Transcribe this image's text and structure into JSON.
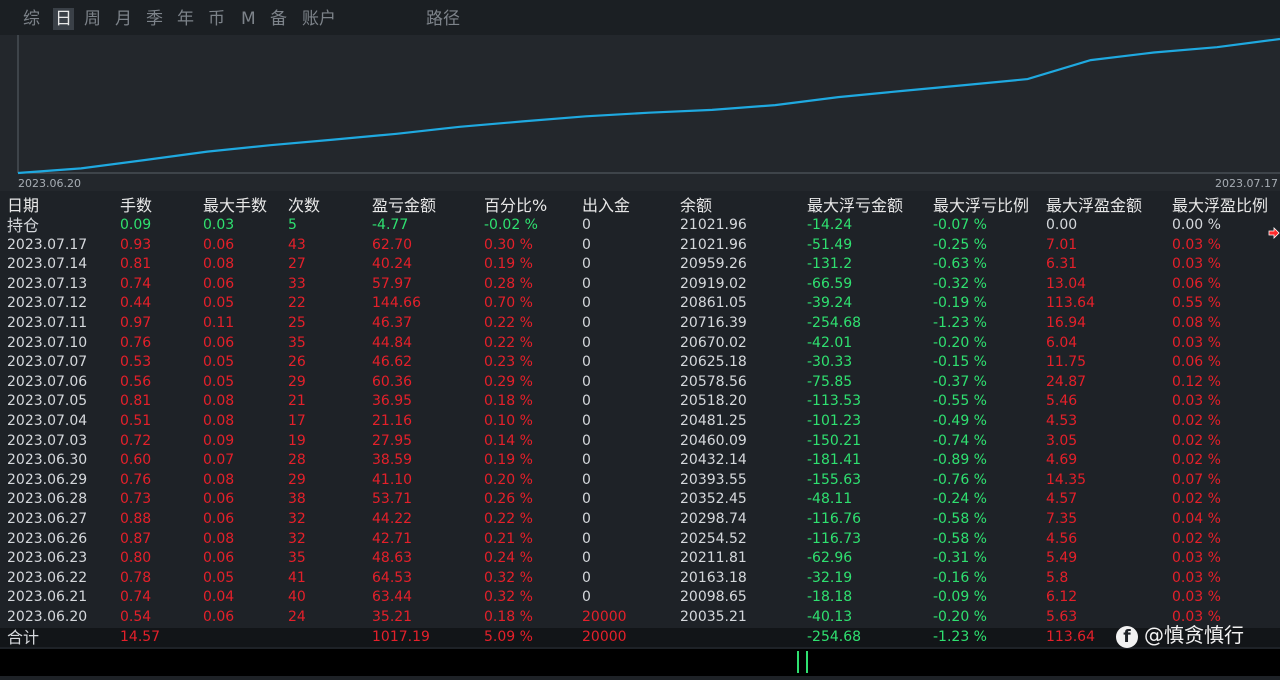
{
  "tabs": [
    "综",
    "日",
    "周",
    "月",
    "季",
    "年",
    "币",
    "M",
    "备",
    "账户",
    "路径"
  ],
  "active_tab": 1,
  "chart": {
    "start_label": "2023.06.20",
    "end_label": "2023.07.17",
    "line_color": "#1fa9e0",
    "series_values": [
      20035.21,
      20098.65,
      20163.18,
      20211.81,
      20254.52,
      20298.74,
      20352.45,
      20393.55,
      20432.14,
      20460.09,
      20481.25,
      20518.2,
      20578.56,
      20625.18,
      20670.02,
      20716.39,
      20861.05,
      20919.02,
      20959.26,
      21021.96
    ],
    "start_value": 20000
  },
  "columns": [
    "日期",
    "手数",
    "最大手数",
    "次数",
    "盈亏金额",
    "百分比%",
    "出入金",
    "余额",
    "最大浮亏金额",
    "最大浮亏比例",
    "最大浮盈金额",
    "最大浮盈比例"
  ],
  "position_row": [
    "持仓",
    "0.09",
    "0.03",
    "5",
    "-4.77",
    "-0.02 %",
    "0",
    "21021.96",
    "-14.24",
    "-0.07 %",
    "0.00",
    "0.00 %"
  ],
  "rows": [
    [
      "2023.07.17",
      "0.93",
      "0.06",
      "43",
      "62.70",
      "0.30 %",
      "0",
      "21021.96",
      "-51.49",
      "-0.25 %",
      "7.01",
      "0.03 %"
    ],
    [
      "2023.07.14",
      "0.81",
      "0.08",
      "27",
      "40.24",
      "0.19 %",
      "0",
      "20959.26",
      "-131.2",
      "-0.63 %",
      "6.31",
      "0.03 %"
    ],
    [
      "2023.07.13",
      "0.74",
      "0.06",
      "33",
      "57.97",
      "0.28 %",
      "0",
      "20919.02",
      "-66.59",
      "-0.32 %",
      "13.04",
      "0.06 %"
    ],
    [
      "2023.07.12",
      "0.44",
      "0.05",
      "22",
      "144.66",
      "0.70 %",
      "0",
      "20861.05",
      "-39.24",
      "-0.19 %",
      "113.64",
      "0.55 %"
    ],
    [
      "2023.07.11",
      "0.97",
      "0.11",
      "25",
      "46.37",
      "0.22 %",
      "0",
      "20716.39",
      "-254.68",
      "-1.23 %",
      "16.94",
      "0.08 %"
    ],
    [
      "2023.07.10",
      "0.76",
      "0.06",
      "35",
      "44.84",
      "0.22 %",
      "0",
      "20670.02",
      "-42.01",
      "-0.20 %",
      "6.04",
      "0.03 %"
    ],
    [
      "2023.07.07",
      "0.53",
      "0.05",
      "26",
      "46.62",
      "0.23 %",
      "0",
      "20625.18",
      "-30.33",
      "-0.15 %",
      "11.75",
      "0.06 %"
    ],
    [
      "2023.07.06",
      "0.56",
      "0.05",
      "29",
      "60.36",
      "0.29 %",
      "0",
      "20578.56",
      "-75.85",
      "-0.37 %",
      "24.87",
      "0.12 %"
    ],
    [
      "2023.07.05",
      "0.81",
      "0.08",
      "21",
      "36.95",
      "0.18 %",
      "0",
      "20518.20",
      "-113.53",
      "-0.55 %",
      "5.46",
      "0.03 %"
    ],
    [
      "2023.07.04",
      "0.51",
      "0.08",
      "17",
      "21.16",
      "0.10 %",
      "0",
      "20481.25",
      "-101.23",
      "-0.49 %",
      "4.53",
      "0.02 %"
    ],
    [
      "2023.07.03",
      "0.72",
      "0.09",
      "19",
      "27.95",
      "0.14 %",
      "0",
      "20460.09",
      "-150.21",
      "-0.74 %",
      "3.05",
      "0.02 %"
    ],
    [
      "2023.06.30",
      "0.60",
      "0.07",
      "28",
      "38.59",
      "0.19 %",
      "0",
      "20432.14",
      "-181.41",
      "-0.89 %",
      "4.69",
      "0.02 %"
    ],
    [
      "2023.06.29",
      "0.76",
      "0.08",
      "29",
      "41.10",
      "0.20 %",
      "0",
      "20393.55",
      "-155.63",
      "-0.76 %",
      "14.35",
      "0.07 %"
    ],
    [
      "2023.06.28",
      "0.73",
      "0.06",
      "38",
      "53.71",
      "0.26 %",
      "0",
      "20352.45",
      "-48.11",
      "-0.24 %",
      "4.57",
      "0.02 %"
    ],
    [
      "2023.06.27",
      "0.88",
      "0.06",
      "32",
      "44.22",
      "0.22 %",
      "0",
      "20298.74",
      "-116.76",
      "-0.58 %",
      "7.35",
      "0.04 %"
    ],
    [
      "2023.06.26",
      "0.87",
      "0.08",
      "32",
      "42.71",
      "0.21 %",
      "0",
      "20254.52",
      "-116.73",
      "-0.58 %",
      "4.56",
      "0.02 %"
    ],
    [
      "2023.06.23",
      "0.80",
      "0.06",
      "35",
      "48.63",
      "0.24 %",
      "0",
      "20211.81",
      "-62.96",
      "-0.31 %",
      "5.49",
      "0.03 %"
    ],
    [
      "2023.06.22",
      "0.78",
      "0.05",
      "41",
      "64.53",
      "0.32 %",
      "0",
      "20163.18",
      "-32.19",
      "-0.16 %",
      "5.8",
      "0.03 %"
    ],
    [
      "2023.06.21",
      "0.74",
      "0.04",
      "40",
      "63.44",
      "0.32 %",
      "0",
      "20098.65",
      "-18.18",
      "-0.09 %",
      "6.12",
      "0.03 %"
    ],
    [
      "2023.06.20",
      "0.54",
      "0.06",
      "24",
      "35.21",
      "0.18 %",
      "20000",
      "20035.21",
      "-40.13",
      "-0.20 %",
      "5.63",
      "0.03 %"
    ]
  ],
  "total_row": [
    "合计",
    "14.57",
    "",
    "",
    "1017.19",
    "5.09 %",
    "20000",
    "",
    "-254.68",
    "-1.23 %",
    "113.64",
    ""
  ],
  "watermark": {
    "icon": "f",
    "text": "@慎贪慎行"
  },
  "colors": {
    "profit": "#e4202a",
    "loss": "#2fe070",
    "neutral": "#d5d8dc",
    "background": "#1e2227"
  }
}
